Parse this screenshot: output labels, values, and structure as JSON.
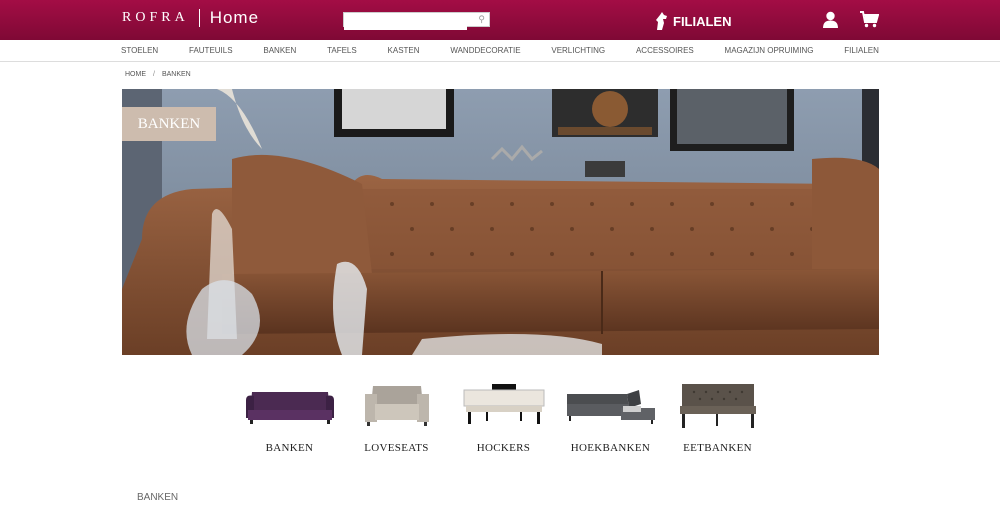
{
  "header": {
    "brand": "ROFRA",
    "brand_sub": "Home",
    "search_placeholder": "",
    "filialen_label": "FILIALEN",
    "colors": {
      "primary": "#8c0b3c"
    }
  },
  "nav": {
    "items": [
      "STOELEN",
      "FAUTEUILS",
      "BANKEN",
      "TAFELS",
      "KASTEN",
      "WANDDECORATIE",
      "VERLICHTING",
      "ACCESSOIRES",
      "MAGAZIJN OPRUIMING",
      "FILIALEN"
    ]
  },
  "breadcrumb": {
    "home": "HOME",
    "sep": "/",
    "current": "BANKEN"
  },
  "hero": {
    "tag": "BANKEN"
  },
  "categories": [
    {
      "label": "BANKEN",
      "icon": "sofa-purple"
    },
    {
      "label": "LOVESEATS",
      "icon": "loveseat-grey"
    },
    {
      "label": "HOCKERS",
      "icon": "hocker"
    },
    {
      "label": "HOEKBANKEN",
      "icon": "corner-sofa"
    },
    {
      "label": "EETBANKEN",
      "icon": "dining-bench"
    }
  ],
  "section": {
    "title": "BANKEN"
  }
}
